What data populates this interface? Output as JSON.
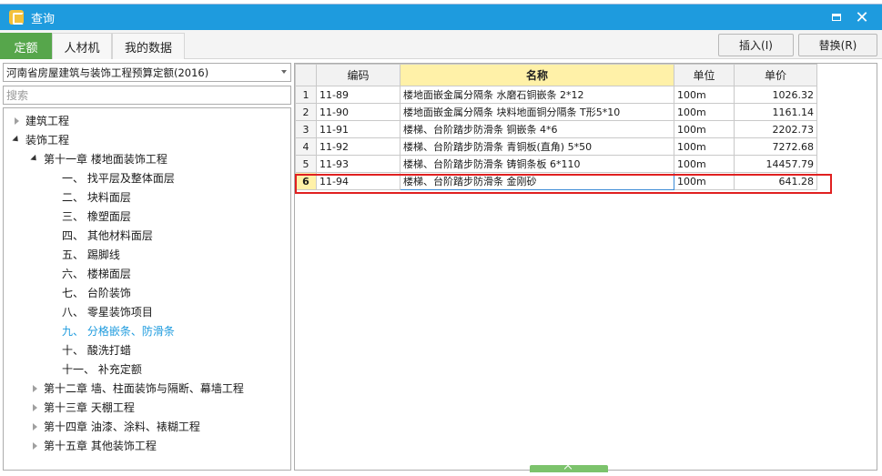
{
  "window": {
    "title": "查询"
  },
  "tabs": [
    {
      "label": "定额",
      "active": true
    },
    {
      "label": "人材机",
      "active": false
    },
    {
      "label": "我的数据",
      "active": false
    }
  ],
  "toolbar": {
    "insert_label": "插入(I)",
    "replace_label": "替换(R)"
  },
  "library": {
    "selected": "河南省房屋建筑与装饰工程预算定额(2016)"
  },
  "search": {
    "placeholder": "搜索"
  },
  "tree": [
    {
      "label": "建筑工程",
      "toggle": "collapsed"
    },
    {
      "label": "装饰工程",
      "toggle": "expanded"
    },
    {
      "label": "第十一章  楼地面装饰工程",
      "toggle": "expanded"
    },
    {
      "label": "一、  找平层及整体面层",
      "toggle": "none"
    },
    {
      "label": "二、  块料面层",
      "toggle": "none"
    },
    {
      "label": "三、  橡塑面层",
      "toggle": "none"
    },
    {
      "label": "四、  其他材料面层",
      "toggle": "none"
    },
    {
      "label": "五、  踢脚线",
      "toggle": "none"
    },
    {
      "label": "六、  楼梯面层",
      "toggle": "none"
    },
    {
      "label": "七、  台阶装饰",
      "toggle": "none"
    },
    {
      "label": "八、  零星装饰项目",
      "toggle": "none"
    },
    {
      "label": "九、  分格嵌条、防滑条",
      "toggle": "none",
      "selected": true
    },
    {
      "label": "十、  酸洗打蜡",
      "toggle": "none"
    },
    {
      "label": "十一、  补充定额",
      "toggle": "none"
    },
    {
      "label": "第十二章  墙、柱面装饰与隔断、幕墙工程",
      "toggle": "collapsed"
    },
    {
      "label": "第十三章  天棚工程",
      "toggle": "collapsed"
    },
    {
      "label": "第十四章  油漆、涂料、裱糊工程",
      "toggle": "collapsed"
    },
    {
      "label": "第十五章  其他装饰工程",
      "toggle": "collapsed"
    }
  ],
  "table": {
    "headers": {
      "code": "编码",
      "name": "名称",
      "unit": "单位",
      "price": "单价"
    },
    "rows": [
      {
        "num": "1",
        "code": "11-89",
        "name": "楼地面嵌金属分隔条  水磨石铜嵌条  2*12",
        "unit": "100m",
        "price": "1026.32"
      },
      {
        "num": "2",
        "code": "11-90",
        "name": "楼地面嵌金属分隔条  块料地面铜分隔条  T形5*10",
        "unit": "100m",
        "price": "1161.14"
      },
      {
        "num": "3",
        "code": "11-91",
        "name": "楼梯、台阶踏步防滑条  铜嵌条  4*6",
        "unit": "100m",
        "price": "2202.73"
      },
      {
        "num": "4",
        "code": "11-92",
        "name": "楼梯、台阶踏步防滑条  青铜板(直角) 5*50",
        "unit": "100m",
        "price": "7272.68"
      },
      {
        "num": "5",
        "code": "11-93",
        "name": "楼梯、台阶踏步防滑条  铸铜条板  6*110",
        "unit": "100m",
        "price": "14457.79"
      },
      {
        "num": "6",
        "code": "11-94",
        "name": "楼梯、台阶踏步防滑条  金刚砂",
        "unit": "100m",
        "price": "641.28",
        "selected": true
      }
    ]
  },
  "colors": {
    "titlebar": "#1e9bde",
    "active_tab": "#56a64b",
    "highlight_box": "#e02020",
    "selected_header": "#fff1a8"
  }
}
